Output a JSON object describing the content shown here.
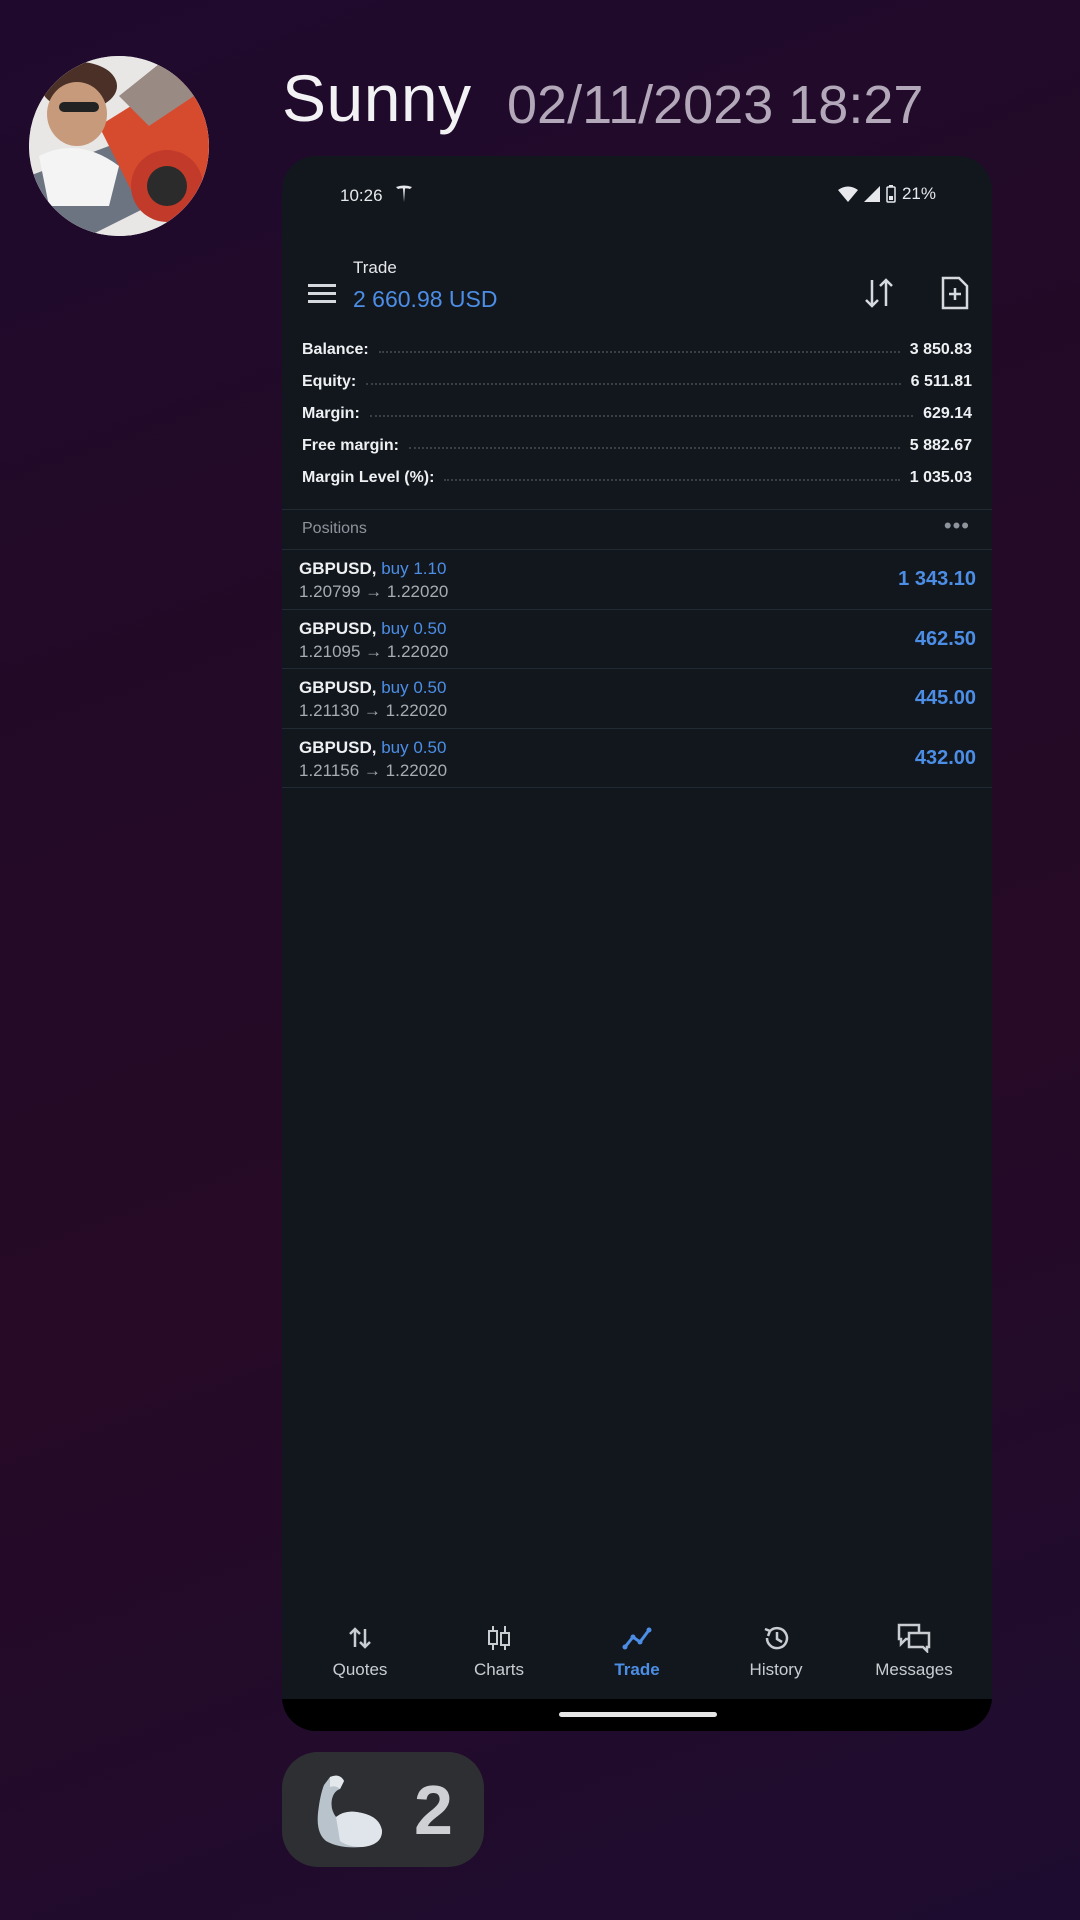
{
  "message": {
    "sender": "Sunny",
    "timestamp": "02/11/2023 18:27",
    "reaction": {
      "icon": "flexed-biceps-icon",
      "count": "2"
    }
  },
  "phone": {
    "status_bar": {
      "time": "10:26",
      "battery": "21%"
    },
    "app_bar": {
      "title": "Trade",
      "value": "2 660.98 USD"
    },
    "summary": [
      {
        "label": "Balance:",
        "value": "3 850.83"
      },
      {
        "label": "Equity:",
        "value": "6 511.81"
      },
      {
        "label": "Margin:",
        "value": "629.14"
      },
      {
        "label": "Free margin:",
        "value": "5 882.67"
      },
      {
        "label": "Margin Level (%):",
        "value": "1 035.03"
      }
    ],
    "positions_header": "Positions",
    "positions": [
      {
        "symbol": "GBPUSD,",
        "side": "buy 1.10",
        "prices": "1.20799 → 1.22020",
        "profit": "1 343.10"
      },
      {
        "symbol": "GBPUSD,",
        "side": "buy 0.50",
        "prices": "1.21095 → 1.22020",
        "profit": "462.50"
      },
      {
        "symbol": "GBPUSD,",
        "side": "buy 0.50",
        "prices": "1.21130 → 1.22020",
        "profit": "445.00"
      },
      {
        "symbol": "GBPUSD,",
        "side": "buy 0.50",
        "prices": "1.21156 → 1.22020",
        "profit": "432.00"
      }
    ],
    "nav": [
      {
        "label": "Quotes",
        "icon": "quotes-icon"
      },
      {
        "label": "Charts",
        "icon": "candlestick-icon"
      },
      {
        "label": "Trade",
        "icon": "trend-icon",
        "active": true
      },
      {
        "label": "History",
        "icon": "history-icon"
      },
      {
        "label": "Messages",
        "icon": "chat-icon"
      }
    ]
  },
  "colors": {
    "accent": "#4c8ee6",
    "app_background": "#12171e",
    "page_background": "#230a26"
  }
}
